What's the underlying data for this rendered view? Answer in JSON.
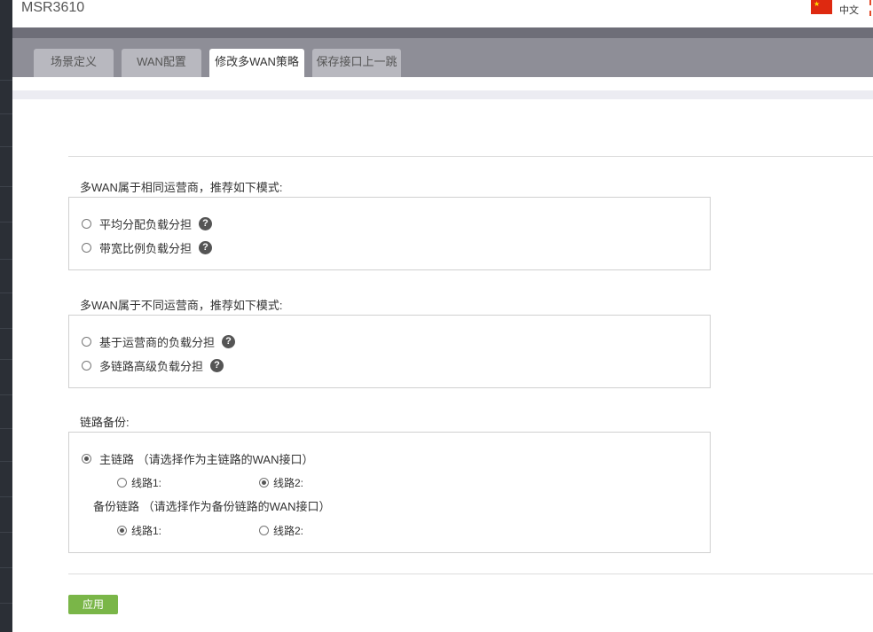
{
  "header": {
    "app_title": "MSR3610",
    "language": "中文"
  },
  "icons": {
    "flag": "china-flag-icon",
    "help": "question-circle-icon"
  },
  "colors": {
    "tab_bar": "#8e8e97",
    "tab_bar_top": "#6e6e78",
    "tab_active": "#ffffff",
    "tab_inactive": "#b8b8bf",
    "apply_button": "#7ab648",
    "side_panel": "#2b2f36"
  },
  "tabs": [
    {
      "label": "场景定义",
      "active": false
    },
    {
      "label": "WAN配置",
      "active": false
    },
    {
      "label": "修改多WAN策略",
      "active": true
    },
    {
      "label": "保存接口上一跳",
      "active": false
    }
  ],
  "same_isp": {
    "label": "多WAN属于相同运营商，推荐如下模式:",
    "options": [
      {
        "label": "平均分配负载分担",
        "selected": false
      },
      {
        "label": "带宽比例负载分担",
        "selected": false
      }
    ]
  },
  "diff_isp": {
    "label": "多WAN属于不同运营商，推荐如下模式:",
    "options": [
      {
        "label": "基于运营商的负载分担",
        "selected": false
      },
      {
        "label": "多链路高级负载分担",
        "selected": false
      }
    ]
  },
  "backup": {
    "label": "链路备份:",
    "primary": {
      "label": "主链路 （请选择作为主链路的WAN接口）",
      "selected": true,
      "lines": [
        {
          "label": "线路1:",
          "selected": false
        },
        {
          "label": "线路2:",
          "selected": true
        }
      ]
    },
    "secondary": {
      "label": "备份链路 （请选择作为备份链路的WAN接口）",
      "lines": [
        {
          "label": "线路1:",
          "selected": true
        },
        {
          "label": "线路2:",
          "selected": false
        }
      ]
    }
  },
  "apply_label": "应用"
}
